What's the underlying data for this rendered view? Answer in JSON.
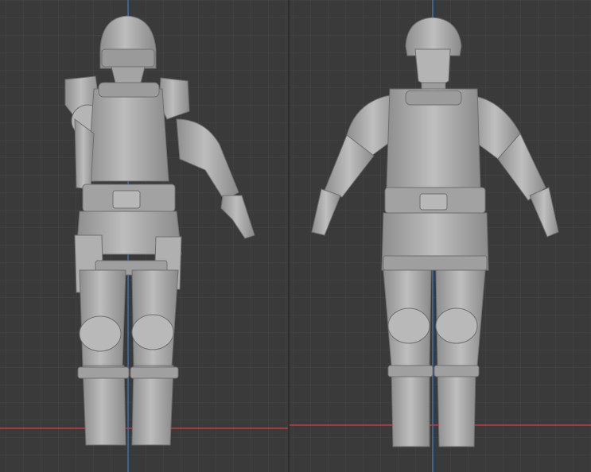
{
  "viewport": {
    "background": "#3a3a3a",
    "grid_minor_color": "#444444",
    "grid_major_color": "#4d4d4d",
    "x_axis_color": "#c23a48",
    "y_axis_color": "#3b6fb5",
    "model_color": "#a9a9a9",
    "model_shadow": "#7a7a7a",
    "model_highlight": "#cfcfcf"
  },
  "panels": [
    {
      "view": "front-orthographic",
      "subject": "armored-soldier-sculpt"
    },
    {
      "view": "front-perspective",
      "subject": "armored-soldier-sculpt"
    }
  ]
}
